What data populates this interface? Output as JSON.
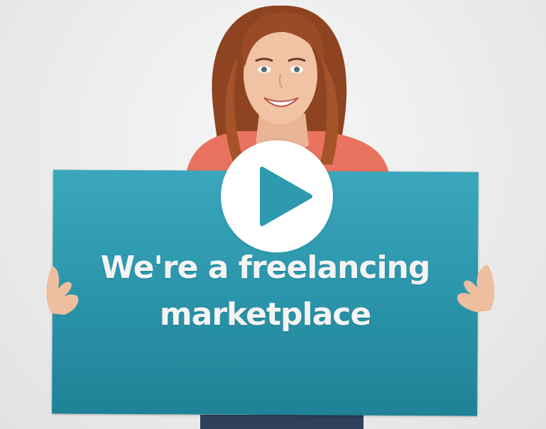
{
  "video": {
    "caption_line1": "We're a freelancing",
    "caption_line2": "marketplace",
    "play_icon": "play-icon",
    "colors": {
      "sign": "#2c97ad",
      "play_button": "#ffffff",
      "play_triangle": "#2e9ab0",
      "shirt": "#e9735f",
      "hair": "#9a4a24"
    }
  }
}
